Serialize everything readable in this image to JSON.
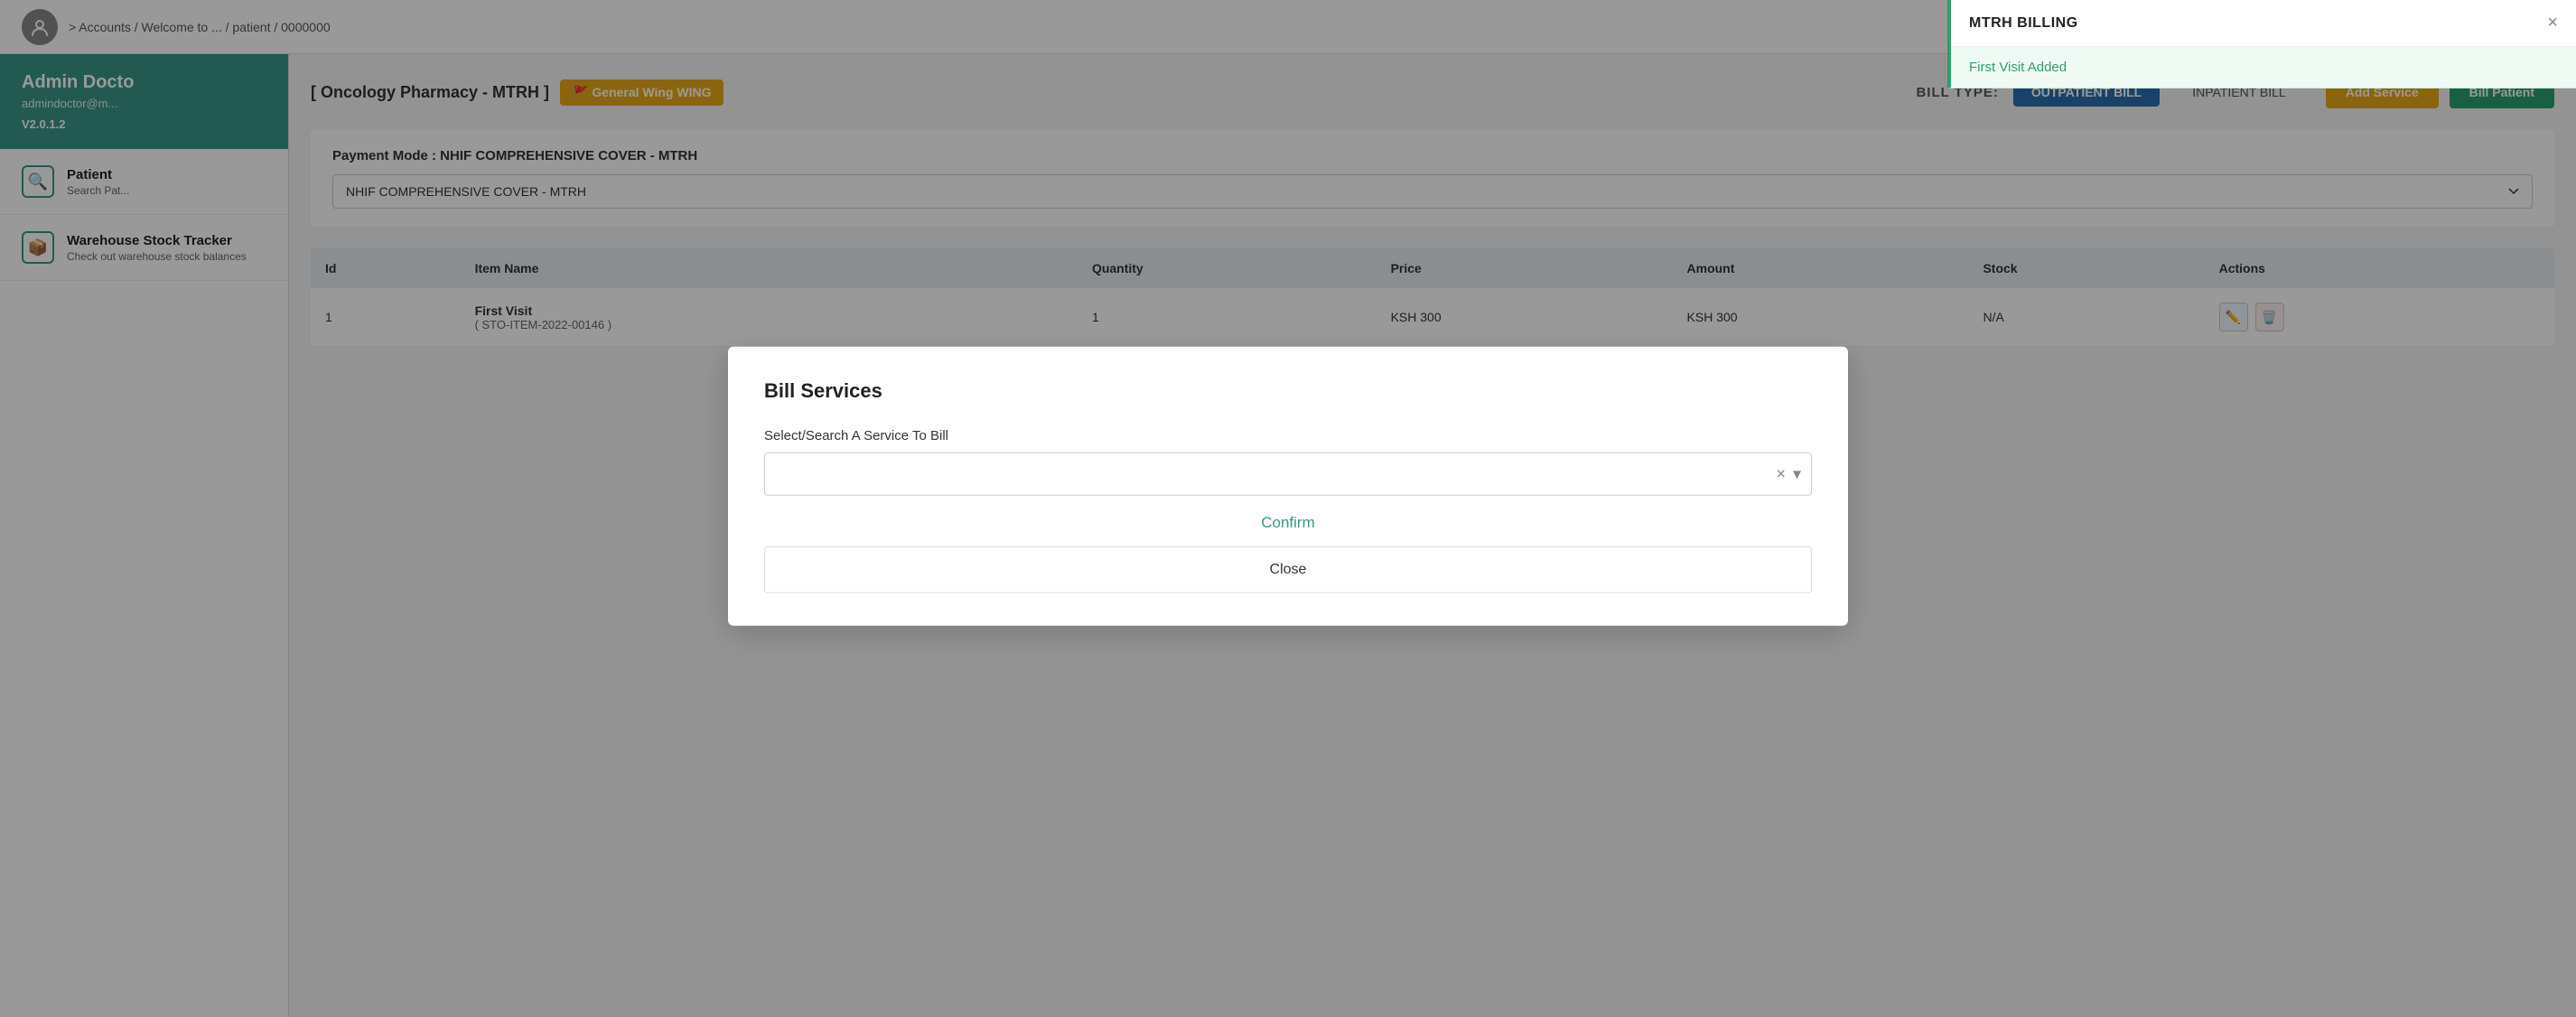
{
  "topNav": {
    "breadcrumb": "> Accounts / Welcome to ... / patient / 0000000"
  },
  "sidebar": {
    "admin": {
      "name": "Admin Docto",
      "email": "admindoctor@m...",
      "version": "V2.0.1.2"
    },
    "menuItems": [
      {
        "icon": "🔍",
        "title": "Patient",
        "subtitle": "Search Pat..."
      },
      {
        "icon": "📦",
        "title": "Warehouse Stock Tracker",
        "subtitle": "Check out warehouse stock balances"
      }
    ]
  },
  "mainContent": {
    "locationTitle": "[ Oncology Pharmacy - MTRH ]",
    "wingBadge": "🚩 General Wing WING",
    "billTypeLabel": "BILL TYPE:",
    "btnOutpatient": "OUTPATIENT BILL",
    "btnInpatient": "INPATIENT BILL",
    "btnAddService": "Add Service",
    "btnBillPatient": "Bill Patient",
    "paymentLabel": "Payment Mode : NHIF COMPREHENSIVE COVER - MTRH",
    "paymentOptions": [
      "NHIF COMPREHENSIVE COVER - MTRH"
    ],
    "paymentSelected": "NHIF COMPREHENSIVE COVER - MTRH",
    "table": {
      "headers": [
        "Id",
        "Item Name",
        "Quantity",
        "Price",
        "Amount",
        "Stock",
        "Actions"
      ],
      "rows": [
        {
          "id": "1",
          "itemName": "First Visit",
          "itemCode": "( STO-ITEM-2022-00146 )",
          "quantity": "1",
          "price": "KSH 300",
          "amount": "KSH 300",
          "stock": "N/A",
          "actions": [
            "edit",
            "delete"
          ]
        }
      ]
    }
  },
  "modal": {
    "title": "Bill Services",
    "searchLabel": "Select/Search A Service To Bill",
    "searchPlaceholder": "",
    "confirmLabel": "Confirm",
    "closeLabel": "Close"
  },
  "toast": {
    "title": "MTRH BILLING",
    "message": "First Visit Added",
    "closeIcon": "×"
  }
}
